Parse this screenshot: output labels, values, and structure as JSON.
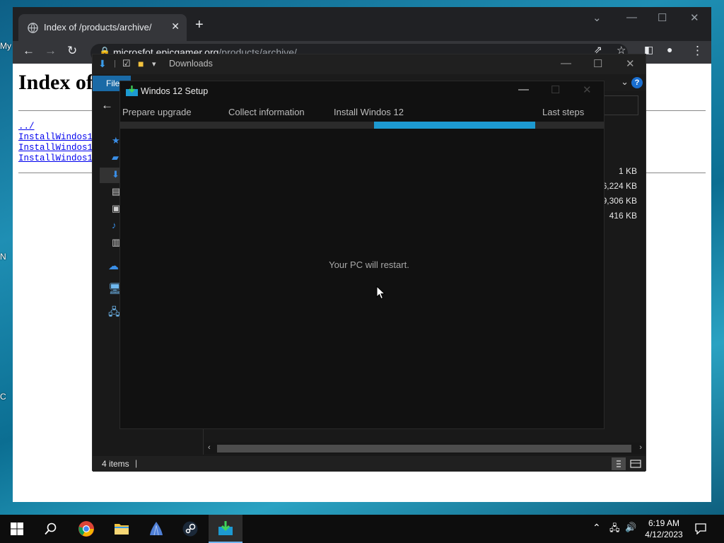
{
  "desktop": {
    "icon_labels": [
      "My",
      "N",
      "C"
    ]
  },
  "chrome": {
    "tab_title": "Index of /products/archive/",
    "url_host": "microsfot.epicgamer.org",
    "url_path": "/products/archive/",
    "page_heading": "Index of /products/archive/",
    "links": [
      "../",
      "InstallWindos12",
      "InstallWindos12",
      "InstallWindos12"
    ]
  },
  "explorer": {
    "title": "Downloads",
    "ribbon_file": "File",
    "sizes": [
      "1 KB",
      "6,224 KB",
      "9,306 KB",
      "416 KB"
    ],
    "status_items": "4 items"
  },
  "setup": {
    "title": "Windos 12 Setup",
    "steps": [
      "Prepare upgrade",
      "Collect information",
      "Install Windos 12",
      "Last steps"
    ],
    "progress_fill_start_fraction": 0.525,
    "progress_fill_end_fraction": 0.858,
    "message": "Your PC will restart."
  },
  "taskbar": {
    "time": "6:19 AM",
    "date": "4/12/2023",
    "apps": [
      "start-button",
      "search-button",
      "chrome-app",
      "file-explorer-app",
      "blue-app",
      "steam-app",
      "windos-setup-app"
    ]
  },
  "colors": {
    "progress": "#1d9ad1",
    "explorer_file_tab": "#1a6aa6",
    "link": "#0000ee"
  }
}
